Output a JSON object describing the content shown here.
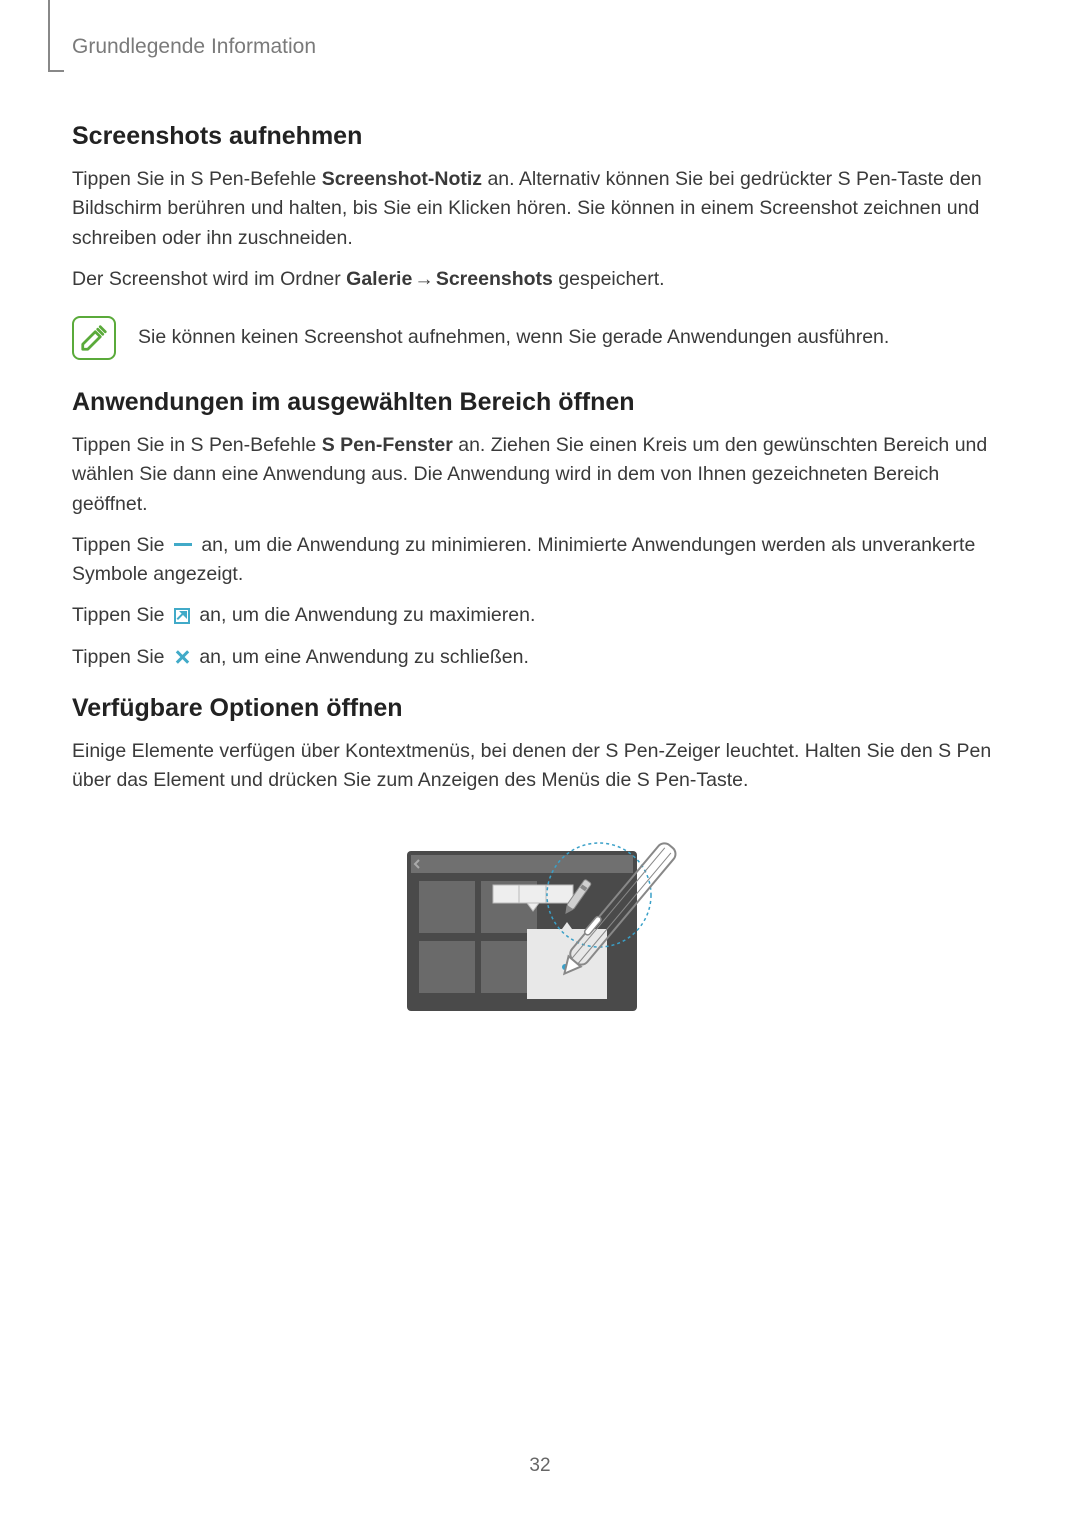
{
  "header": "Grundlegende Information",
  "section1": {
    "heading": "Screenshots aufnehmen",
    "p1_a": "Tippen Sie in S Pen-Befehle ",
    "p1_bold": "Screenshot-Notiz",
    "p1_b": " an. Alternativ können Sie bei gedrückter S Pen-Taste den Bildschirm berühren und halten, bis Sie ein Klicken hören. Sie können in einem Screenshot zeichnen und schreiben oder ihn zuschneiden.",
    "p2_a": "Der Screenshot wird im Ordner ",
    "p2_bold1": "Galerie",
    "p2_arrow": " → ",
    "p2_bold2": "Screenshots",
    "p2_b": " gespeichert.",
    "note": "Sie können keinen Screenshot aufnehmen, wenn Sie gerade Anwendungen ausführen."
  },
  "section2": {
    "heading": "Anwendungen im ausgewählten Bereich öffnen",
    "p1_a": "Tippen Sie in S Pen-Befehle ",
    "p1_bold": "S Pen-Fenster",
    "p1_b": " an. Ziehen Sie einen Kreis um den gewünschten Bereich und wählen Sie dann eine Anwendung aus. Die Anwendung wird in dem von Ihnen gezeichneten Bereich geöffnet.",
    "p2_a": "Tippen Sie ",
    "p2_b": " an, um die Anwendung zu minimieren. Minimierte Anwendungen werden als unverankerte Symbole angezeigt.",
    "p3_a": "Tippen Sie ",
    "p3_b": " an, um die Anwendung zu maximieren.",
    "p4_a": "Tippen Sie ",
    "p4_b": " an, um eine Anwendung zu schließen."
  },
  "section3": {
    "heading": "Verfügbare Optionen öffnen",
    "p1": "Einige Elemente verfügen über Kontextmenüs, bei denen der S Pen-Zeiger leuchtet. Halten Sie den S Pen über das Element und drücken Sie zum Anzeigen des Menüs die S Pen-Taste."
  },
  "page_number": "32"
}
